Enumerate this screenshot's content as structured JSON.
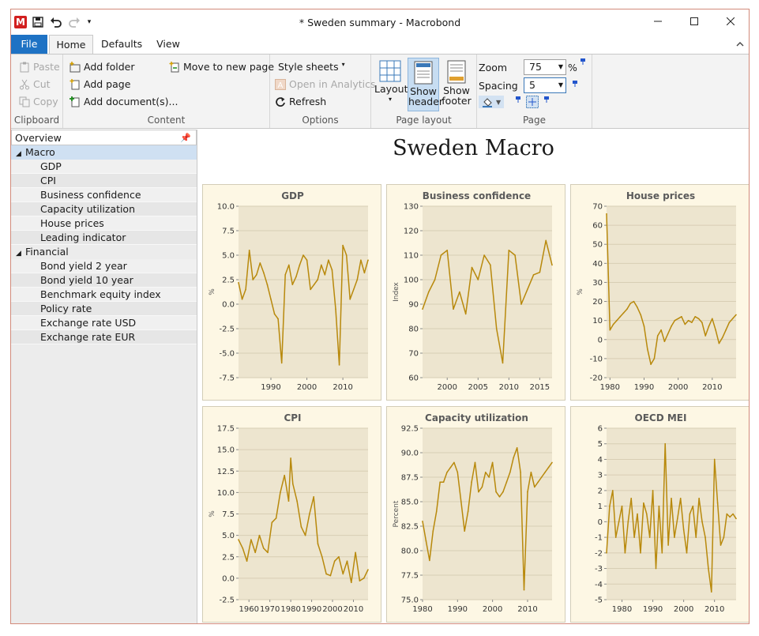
{
  "window": {
    "title": "* Sweden summary - Macrobond",
    "logo": "M"
  },
  "tabs": [
    "File",
    "Home",
    "Defaults",
    "View"
  ],
  "ribbon": {
    "clipboard": {
      "label": "Clipboard",
      "paste": "Paste",
      "cut": "Cut",
      "copy": "Copy"
    },
    "content": {
      "label": "Content",
      "add_folder": "Add folder",
      "add_page": "Add page",
      "add_documents": "Add document(s)...",
      "move_to_new_page": "Move to new page"
    },
    "options": {
      "label": "Options",
      "style_sheets": "Style sheets",
      "open_in_analytics": "Open in Analytics",
      "refresh": "Refresh"
    },
    "page_layout": {
      "label": "Page layout",
      "layout": "Layout",
      "show_header_line1": "Show",
      "show_header_line2": "header",
      "show_footer_line1": "Show",
      "show_footer_line2": "footer"
    },
    "page": {
      "label": "Page",
      "zoom_label": "Zoom",
      "zoom_value": "75",
      "zoom_unit": "%",
      "spacing_label": "Spacing",
      "spacing_value": "5"
    }
  },
  "overview": {
    "title": "Overview",
    "folders": [
      {
        "name": "Macro",
        "items": [
          "GDP",
          "CPI",
          "Business confidence",
          "Capacity utilization",
          "House prices",
          "Leading indicator"
        ]
      },
      {
        "name": "Financial",
        "items": [
          "Bond yield 2 year",
          "Bond yield 10 year",
          "Benchmark equity index",
          "Policy rate",
          "Exchange rate USD",
          "Exchange rate EUR"
        ]
      }
    ]
  },
  "document": {
    "title": "Sweden Macro"
  },
  "colors": {
    "accent": "#1e72c4",
    "series": "#b8890c",
    "plot_bg": "#ede5cf",
    "card_bg": "#fdf7e4"
  },
  "chart_data": [
    {
      "type": "line",
      "title": "GDP",
      "ylabel": "%",
      "ylim": [
        -7.5,
        10
      ],
      "yticks": [
        10.0,
        7.5,
        5.0,
        2.5,
        0.0,
        -2.5,
        -5.0,
        -7.5
      ],
      "xlim": [
        1981,
        2017
      ],
      "xticks": [
        1990,
        2000,
        2010
      ],
      "x": [
        1981,
        1982,
        1983,
        1984,
        1985,
        1986,
        1987,
        1988,
        1989,
        1990,
        1991,
        1992,
        1993,
        1994,
        1995,
        1996,
        1997,
        1998,
        1999,
        2000,
        2001,
        2002,
        2003,
        2004,
        2005,
        2006,
        2007,
        2008,
        2009,
        2010,
        2011,
        2012,
        2013,
        2014,
        2015,
        2016,
        2017
      ],
      "values": [
        2.2,
        0.5,
        1.5,
        5.5,
        2.5,
        3.0,
        4.2,
        3.2,
        2.0,
        0.5,
        -1.0,
        -1.5,
        -6.0,
        3.0,
        4.0,
        2.0,
        2.8,
        4.0,
        5.0,
        4.5,
        1.5,
        2.0,
        2.5,
        4.0,
        3.0,
        4.5,
        3.5,
        -0.5,
        -6.2,
        6.0,
        5.0,
        0.5,
        1.5,
        2.5,
        4.5,
        3.2,
        4.5
      ]
    },
    {
      "type": "line",
      "title": "Business confidence",
      "ylabel": "Index",
      "ylim": [
        60,
        130
      ],
      "yticks": [
        130,
        120,
        110,
        100,
        90,
        80,
        70,
        60
      ],
      "xlim": [
        1996,
        2017
      ],
      "xticks": [
        2000,
        2005,
        2010,
        2015
      ],
      "x": [
        1996,
        1997,
        1998,
        1999,
        2000,
        2001,
        2002,
        2003,
        2004,
        2005,
        2006,
        2007,
        2008,
        2009,
        2010,
        2011,
        2012,
        2013,
        2014,
        2015,
        2016,
        2017
      ],
      "values": [
        88,
        95,
        100,
        110,
        112,
        88,
        95,
        86,
        105,
        100,
        110,
        106,
        80,
        66,
        112,
        110,
        90,
        96,
        102,
        103,
        116,
        106
      ]
    },
    {
      "type": "line",
      "title": "House prices",
      "ylabel": "%",
      "ylim": [
        -20,
        70
      ],
      "yticks": [
        70,
        60,
        50,
        40,
        30,
        20,
        10,
        0,
        -10,
        -20
      ],
      "xlim": [
        1979,
        2017
      ],
      "xticks": [
        1980,
        1990,
        2000,
        2010
      ],
      "x": [
        1979,
        1980,
        1981,
        1982,
        1983,
        1984,
        1985,
        1986,
        1987,
        1988,
        1989,
        1990,
        1991,
        1992,
        1993,
        1994,
        1995,
        1996,
        1997,
        1998,
        1999,
        2000,
        2001,
        2002,
        2003,
        2004,
        2005,
        2006,
        2007,
        2008,
        2009,
        2010,
        2011,
        2012,
        2013,
        2014,
        2015,
        2016,
        2017
      ],
      "values": [
        66,
        5,
        8,
        10,
        12,
        14,
        16,
        19,
        20,
        17,
        13,
        7,
        -5,
        -13,
        -10,
        2,
        5,
        -1,
        3,
        7,
        10,
        11,
        12,
        8,
        10,
        9,
        12,
        11,
        9,
        2,
        7,
        11,
        5,
        -2,
        1,
        5,
        9,
        11,
        13
      ]
    },
    {
      "type": "line",
      "title": "CPI",
      "ylabel": "%",
      "ylim": [
        -2.5,
        17.5
      ],
      "yticks": [
        17.5,
        15.0,
        12.5,
        10.0,
        7.5,
        5.0,
        2.5,
        0.0,
        -2.5
      ],
      "xlim": [
        1955,
        2017
      ],
      "xticks": [
        1960,
        1970,
        1980,
        1990,
        2000,
        2010
      ],
      "x": [
        1955,
        1957,
        1959,
        1961,
        1963,
        1965,
        1967,
        1969,
        1971,
        1973,
        1975,
        1977,
        1979,
        1980,
        1981,
        1983,
        1985,
        1987,
        1989,
        1991,
        1993,
        1995,
        1997,
        1999,
        2001,
        2003,
        2005,
        2007,
        2009,
        2011,
        2013,
        2015,
        2017
      ],
      "values": [
        4.5,
        3.5,
        2.0,
        4.5,
        3.0,
        5.0,
        3.5,
        3.0,
        6.5,
        7.0,
        10.0,
        12.0,
        9.0,
        14.0,
        11.0,
        9.0,
        6.0,
        5.0,
        7.5,
        9.5,
        4.0,
        2.5,
        0.5,
        0.3,
        2.0,
        2.5,
        0.5,
        2.0,
        -0.5,
        3.0,
        -0.3,
        0.0,
        1.0
      ]
    },
    {
      "type": "line",
      "title": "Capacity utilization",
      "ylabel": "Percent",
      "ylim": [
        75,
        92.5
      ],
      "yticks": [
        92.5,
        90.0,
        87.5,
        85.0,
        82.5,
        80.0,
        77.5,
        75.0
      ],
      "xlim": [
        1980,
        2017
      ],
      "xticks": [
        1980,
        1990,
        2000,
        2010
      ],
      "x": [
        1980,
        1981,
        1982,
        1983,
        1984,
        1985,
        1986,
        1987,
        1988,
        1989,
        1990,
        1991,
        1992,
        1993,
        1994,
        1995,
        1996,
        1997,
        1998,
        1999,
        2000,
        2001,
        2002,
        2003,
        2004,
        2005,
        2006,
        2007,
        2008,
        2009,
        2010,
        2011,
        2012,
        2013,
        2014,
        2015,
        2016,
        2017
      ],
      "values": [
        83,
        81,
        79,
        82,
        84,
        87,
        87,
        88,
        88.5,
        89,
        88,
        85,
        82,
        84,
        87,
        89,
        86,
        86.5,
        88,
        87.5,
        89,
        86,
        85.5,
        86,
        87,
        88,
        89.5,
        90.5,
        88,
        76,
        86,
        88,
        86.5,
        87,
        87.5,
        88,
        88.5,
        89
      ]
    },
    {
      "type": "line",
      "title": "OECD MEI",
      "ylim": [
        -5,
        6
      ],
      "yticks": [
        6,
        5,
        4,
        3,
        2,
        1,
        0,
        -1,
        -2,
        -3,
        -4,
        -5
      ],
      "xlim": [
        1975,
        2017
      ],
      "xticks": [
        1980,
        1990,
        2000,
        2010
      ],
      "x": [
        1975,
        1976,
        1977,
        1978,
        1979,
        1980,
        1981,
        1982,
        1983,
        1984,
        1985,
        1986,
        1987,
        1988,
        1989,
        1990,
        1991,
        1992,
        1993,
        1994,
        1995,
        1996,
        1997,
        1998,
        1999,
        2000,
        2001,
        2002,
        2003,
        2004,
        2005,
        2006,
        2007,
        2008,
        2009,
        2010,
        2011,
        2012,
        2013,
        2014,
        2015,
        2016,
        2017
      ],
      "values": [
        -2,
        1,
        2,
        -1,
        0,
        1,
        -2,
        0,
        1.5,
        -1,
        0.5,
        -2,
        1.2,
        0.5,
        -1,
        2,
        -3,
        1,
        -2,
        5,
        -1.5,
        1.5,
        -1,
        0.2,
        1.5,
        -0.5,
        -2,
        0.5,
        1,
        -1,
        1.5,
        0,
        -1,
        -3,
        -4.5,
        4,
        1.2,
        -1.5,
        -1,
        0.5,
        0.3,
        0.5,
        0.2
      ]
    }
  ]
}
